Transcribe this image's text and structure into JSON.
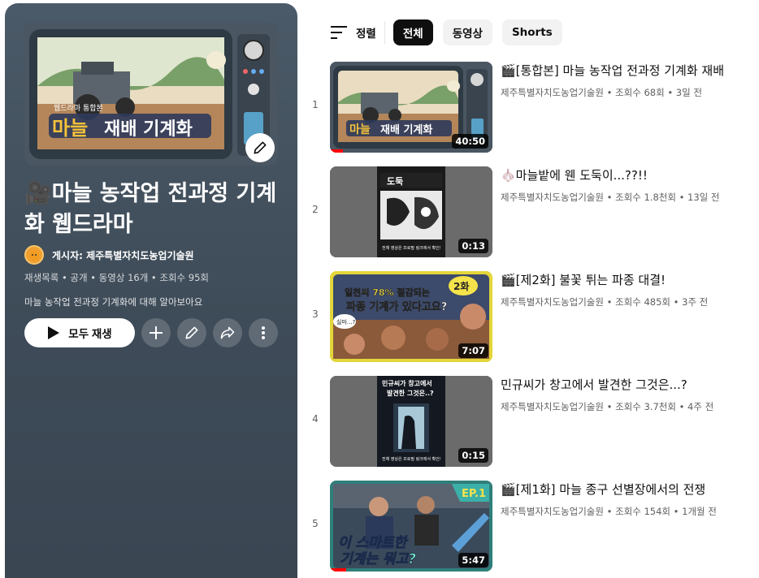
{
  "playlist": {
    "title_icon": "🎥",
    "title": "마늘 농작업 전과정 기계화 웹드라마",
    "owner": "게시자: 제주특별자치도농업기술원",
    "meta": "재생목록 • 공개 • 동영상 16개 • 조회수 95회",
    "description": "마늘 농작업 전과정 기계화에 대해 알아보아요",
    "play_all_label": "모두 재생",
    "cover_text": {
      "badge": "웹드라마 통합본",
      "line1": "마늘",
      "line2": "재배 기계화"
    }
  },
  "filters": {
    "sort_label": "정렬",
    "chips": [
      "전체",
      "동영상",
      "Shorts"
    ],
    "active_chip": "전체"
  },
  "videos": [
    {
      "index": "1",
      "title": "🎬[통합본] 마늘 농작업 전과정 기계화 재배",
      "channel": "제주특별자치도농업기술원",
      "views": "조회수 68회",
      "age": "3일 전",
      "duration": "40:50",
      "progress": 0.1
    },
    {
      "index": "2",
      "title": "🧄마늘밭에 웬 도둑이...??!!",
      "channel": "제주특별자치도농업기술원",
      "views": "조회수 1.8천회",
      "age": "13일 전",
      "duration": "0:13",
      "progress": 0
    },
    {
      "index": "3",
      "title": "🎬[제2화] 불꽃 튀는 파종 대결!",
      "channel": "제주특별자치도농업기술원",
      "views": "조회수 485회",
      "age": "3주 전",
      "duration": "7:07",
      "progress": 0
    },
    {
      "index": "4",
      "title": "민규씨가 창고에서 발견한 그것은...?",
      "channel": "제주특별자치도농업기술원",
      "views": "조회수 3.7천회",
      "age": "4주 전",
      "duration": "0:15",
      "progress": 0
    },
    {
      "index": "5",
      "title": "🎬[제1화] 마늘 종구 선별장에서의 전쟁",
      "channel": "제주특별자치도농업기술원",
      "views": "조회수 154회",
      "age": "1개월 전",
      "duration": "5:47",
      "progress": 0.1
    }
  ],
  "thumb_text": {
    "t2": {
      "top": "도둑",
      "bottom": "전체 영상은 프로필 링크에서 확인!"
    },
    "t3": {
      "headline1": "일천씨 78% 절감되는",
      "headline2": "파종 기계가 있다고요?",
      "ep": "2화",
      "bubble": "실마...?"
    },
    "t4": {
      "line1": "민규씨가 창고에서",
      "line2": "발견한 그것은..?",
      "bottom": "전체 영상은 프로필 링크에서 확인!"
    },
    "t5": {
      "ep": "EP.1",
      "line1": "이 스마트한",
      "line2": "기계는 뭐고?"
    }
  }
}
